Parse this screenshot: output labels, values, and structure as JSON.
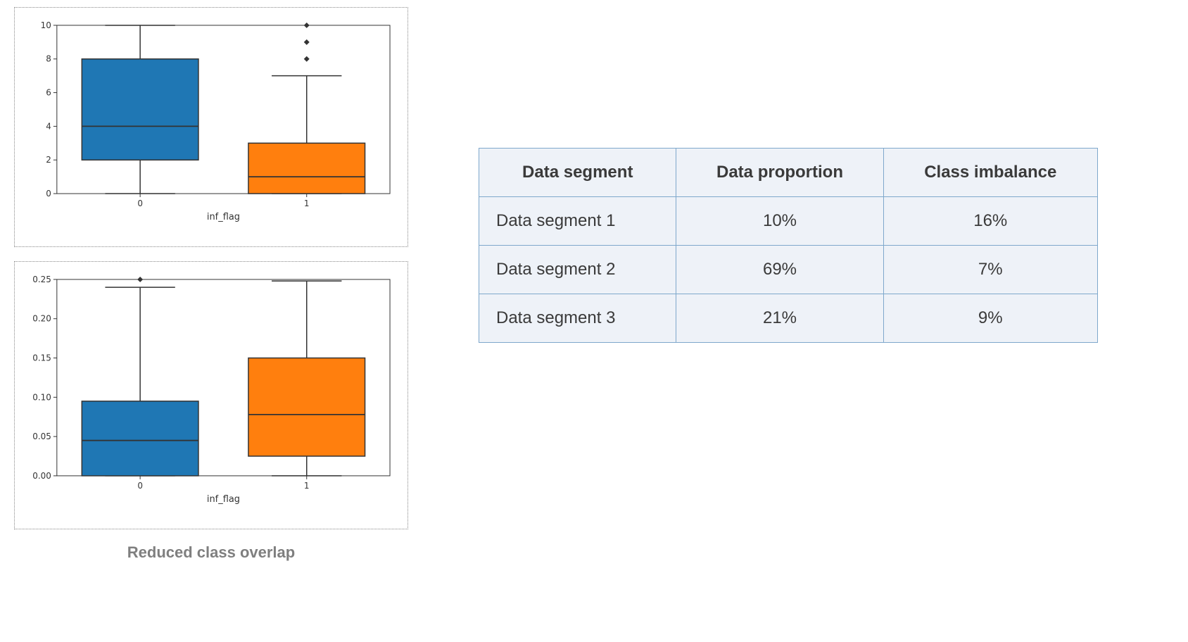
{
  "chart_data": [
    {
      "type": "boxplot",
      "title": "",
      "xlabel": "inf_flag",
      "ylabel": "",
      "ylim": [
        0,
        10
      ],
      "yticks": [
        0,
        2,
        4,
        6,
        8,
        10
      ],
      "categories": [
        "0",
        "1"
      ],
      "boxes": [
        {
          "category": "0",
          "whisker_low": 0,
          "q1": 2,
          "median": 4,
          "q3": 8,
          "whisker_high": 10,
          "outliers": [],
          "color": "#1f77b4"
        },
        {
          "category": "1",
          "whisker_low": 0,
          "q1": 0,
          "median": 1,
          "q3": 3,
          "whisker_high": 7,
          "outliers": [
            8,
            9,
            10
          ],
          "color": "#ff7f0e"
        }
      ]
    },
    {
      "type": "boxplot",
      "title": "",
      "xlabel": "inf_flag",
      "ylabel": "",
      "ylim": [
        0.0,
        0.25
      ],
      "yticks": [
        0.0,
        0.05,
        0.1,
        0.15,
        0.2,
        0.25
      ],
      "categories": [
        "0",
        "1"
      ],
      "boxes": [
        {
          "category": "0",
          "whisker_low": 0.0,
          "q1": 0.0,
          "median": 0.045,
          "q3": 0.095,
          "whisker_high": 0.24,
          "outliers": [
            0.25
          ],
          "color": "#1f77b4"
        },
        {
          "category": "1",
          "whisker_low": 0.0,
          "q1": 0.025,
          "median": 0.078,
          "q3": 0.15,
          "whisker_high": 0.248,
          "outliers": [],
          "color": "#ff7f0e"
        }
      ]
    }
  ],
  "caption": "Reduced class overlap",
  "table": {
    "headers": [
      "Data segment",
      "Data proportion",
      "Class imbalance"
    ],
    "rows": [
      [
        "Data segment 1",
        "10%",
        "16%"
      ],
      [
        "Data segment 2",
        "69%",
        "7%"
      ],
      [
        "Data segment 3",
        "21%",
        "9%"
      ]
    ]
  }
}
